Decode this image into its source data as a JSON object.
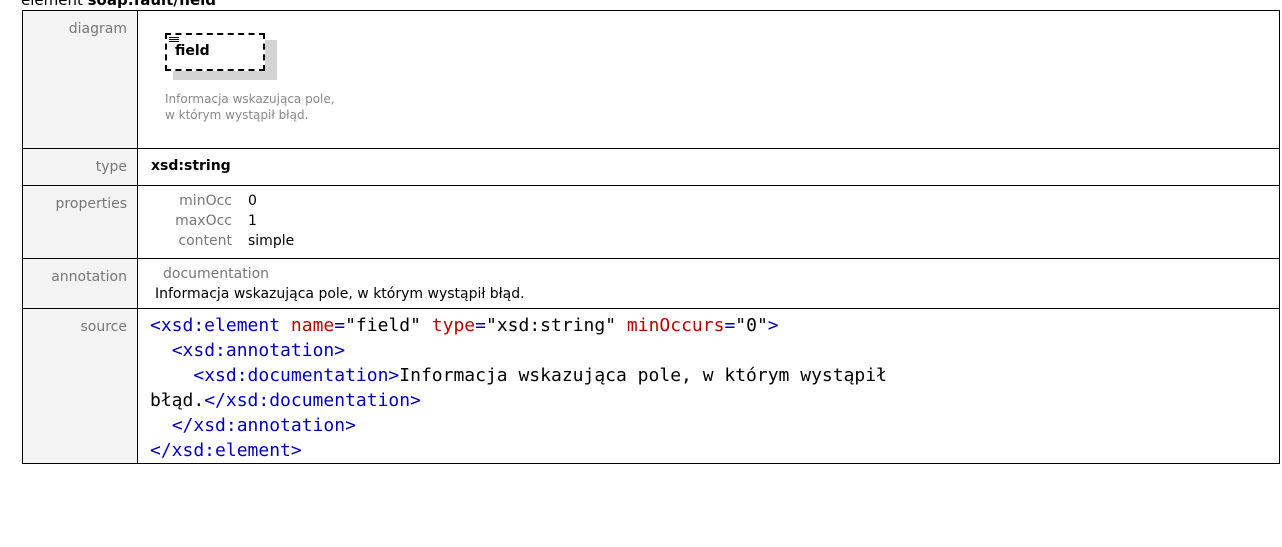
{
  "heading": {
    "prefix": "element ",
    "name": "soap:fault/field"
  },
  "labels": {
    "diagram": "diagram",
    "type": "type",
    "properties": "properties",
    "annotation": "annotation",
    "source": "source"
  },
  "diagram": {
    "element_name": "field",
    "doc_line1": "Informacja wskazująca pole,",
    "doc_line2": "w którym wystąpił błąd."
  },
  "type_value": "xsd:string",
  "properties": [
    {
      "name": "minOcc",
      "value": "0"
    },
    {
      "name": "maxOcc",
      "value": "1"
    },
    {
      "name": "content",
      "value": "simple"
    }
  ],
  "annotation": {
    "heading": "documentation",
    "text": "Informacja wskazująca pole, w którym wystąpił błąd."
  },
  "source": {
    "l1_open": "<xsd:element",
    "l1_attr1": "name",
    "l1_val1": "\"field\"",
    "l1_attr2": "type",
    "l1_val2": "\"xsd:string\"",
    "l1_attr3": "minOccurs",
    "l1_val3": "\"0\"",
    "l2": "<xsd:annotation>",
    "l3_open": "<xsd:documentation>",
    "l3_text": "Informacja wskazująca pole, w którym wystąpił",
    "l4_text": "błąd.",
    "l4_close": "</xsd:documentation>",
    "l5": "</xsd:annotation>",
    "l6": "</xsd:element>"
  }
}
